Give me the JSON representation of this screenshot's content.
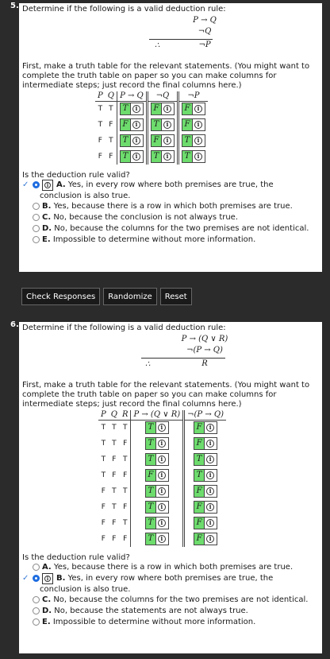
{
  "q5": {
    "number": "5.",
    "prompt": "Determine if the following is a valid deduction rule:",
    "premise1": "P → Q",
    "premise2": "¬Q",
    "therefore": "∴",
    "conclusion": "¬P",
    "intro": "First, make a truth table for the relevant statements. (You might want to complete the truth table on paper so you can make columns for intermediate steps; just record the final columns here.)",
    "headers": [
      "P",
      "Q",
      "P → Q",
      "¬Q",
      "¬P"
    ],
    "rows": [
      [
        "T",
        "T",
        "T",
        "F",
        "F"
      ],
      [
        "T",
        "F",
        "F",
        "T",
        "F"
      ],
      [
        "F",
        "T",
        "T",
        "F",
        "T"
      ],
      [
        "F",
        "F",
        "T",
        "T",
        "T"
      ]
    ],
    "info_glyph": "i",
    "ask": "Is the deduction rule valid?",
    "check_mark": "✓",
    "options": [
      {
        "letter": "A.",
        "text": "Yes, in every row where both premises are true, the",
        "cont": "conclusion is also true."
      },
      {
        "letter": "B.",
        "text": "Yes, because there is a row in which both premises are true."
      },
      {
        "letter": "C.",
        "text": "No, because the conclusion is not always true."
      },
      {
        "letter": "D.",
        "text": "No, because the columns for the two premises are not identical."
      },
      {
        "letter": "E.",
        "text": "Impossible to determine without more information."
      }
    ]
  },
  "buttons": {
    "check": "Check Responses",
    "randomize": "Randomize",
    "reset": "Reset"
  },
  "q6": {
    "number": "6.",
    "prompt": "Determine if the following is a valid deduction rule:",
    "premise1": "P → (Q ∨ R)",
    "premise2": "¬(P → Q)",
    "therefore": "∴",
    "conclusion": "R",
    "intro": "First, make a truth table for the relevant statements. (You might want to complete the truth table on paper so you can make columns for intermediate steps; just record the final columns here.)",
    "headers": [
      "P",
      "Q",
      "R",
      "P → (Q ∨ R)",
      "¬(P → Q)"
    ],
    "rows": [
      [
        "T",
        "T",
        "T",
        "T",
        "F"
      ],
      [
        "T",
        "T",
        "F",
        "T",
        "F"
      ],
      [
        "T",
        "F",
        "T",
        "T",
        "T"
      ],
      [
        "T",
        "F",
        "F",
        "F",
        "T"
      ],
      [
        "F",
        "T",
        "T",
        "T",
        "F"
      ],
      [
        "F",
        "T",
        "F",
        "T",
        "F"
      ],
      [
        "F",
        "F",
        "T",
        "T",
        "F"
      ],
      [
        "F",
        "F",
        "F",
        "T",
        "F"
      ]
    ],
    "ask": "Is the deduction rule valid?",
    "check_mark": "✓",
    "options": [
      {
        "letter": "A.",
        "text": "Yes, because there is a row in which both premises are true."
      },
      {
        "letter": "B.",
        "text": "Yes, in every row where both premises are true, the",
        "cont": "conclusion is also true."
      },
      {
        "letter": "C.",
        "text": "No, because the columns for the two premises are not identical."
      },
      {
        "letter": "D.",
        "text": "No, because the statements are not always true."
      },
      {
        "letter": "E.",
        "text": "Impossible to determine without more information."
      }
    ]
  }
}
